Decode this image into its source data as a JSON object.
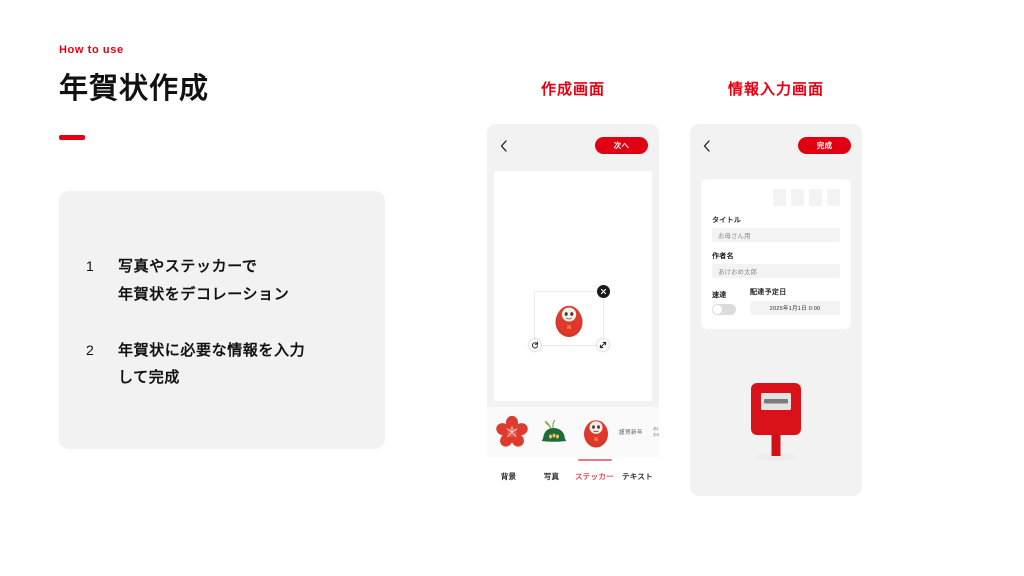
{
  "header": {
    "eyebrow": "How to use",
    "title": "年賀状作成"
  },
  "steps": [
    {
      "number": "1",
      "line1": "写真やステッカーで",
      "line2": "年賀状をデコレーション"
    },
    {
      "number": "2",
      "line1": "年賀状に必要な情報を入力",
      "line2": "して完成"
    }
  ],
  "phone_create": {
    "caption": "作成画面",
    "back_icon": "chevron-left-icon",
    "next_button": "次へ",
    "canvas": {
      "sticker": "daruma-sticker",
      "close_handle": "✕",
      "rotate_handle": "rotate-icon",
      "resize_handle": "resize-icon"
    },
    "tray": {
      "items": [
        "plum-blossom-sticker",
        "pine-sticker",
        "daruma-sticker"
      ],
      "text_sticker_1": "謹賀新年",
      "text_sticker_2a": "あけ",
      "text_sticker_2b": "おめ"
    },
    "tabs": [
      {
        "label": "背景",
        "active": false
      },
      {
        "label": "写真",
        "active": false
      },
      {
        "label": "ステッカー",
        "active": true
      },
      {
        "label": "テキスト",
        "active": false
      }
    ]
  },
  "phone_info": {
    "caption": "情報入力画面",
    "back_icon": "chevron-left-icon",
    "done_button": "完成",
    "form": {
      "thumbnails_count": 4,
      "title_label": "タイトル",
      "title_value": "お母さん用",
      "author_label": "作者名",
      "author_value": "あけおめ太郎",
      "express_label": "速達",
      "express_on": false,
      "delivery_label": "配達予定日",
      "delivery_value": "2025年1月1日 0:00"
    },
    "illustration": "mailbox-icon"
  },
  "colors": {
    "accent_red": "#e60012",
    "button_red": "#e00012",
    "tab_active": "#e8425a",
    "card_gray": "#f2f2f2",
    "text_dark": "#111111"
  }
}
